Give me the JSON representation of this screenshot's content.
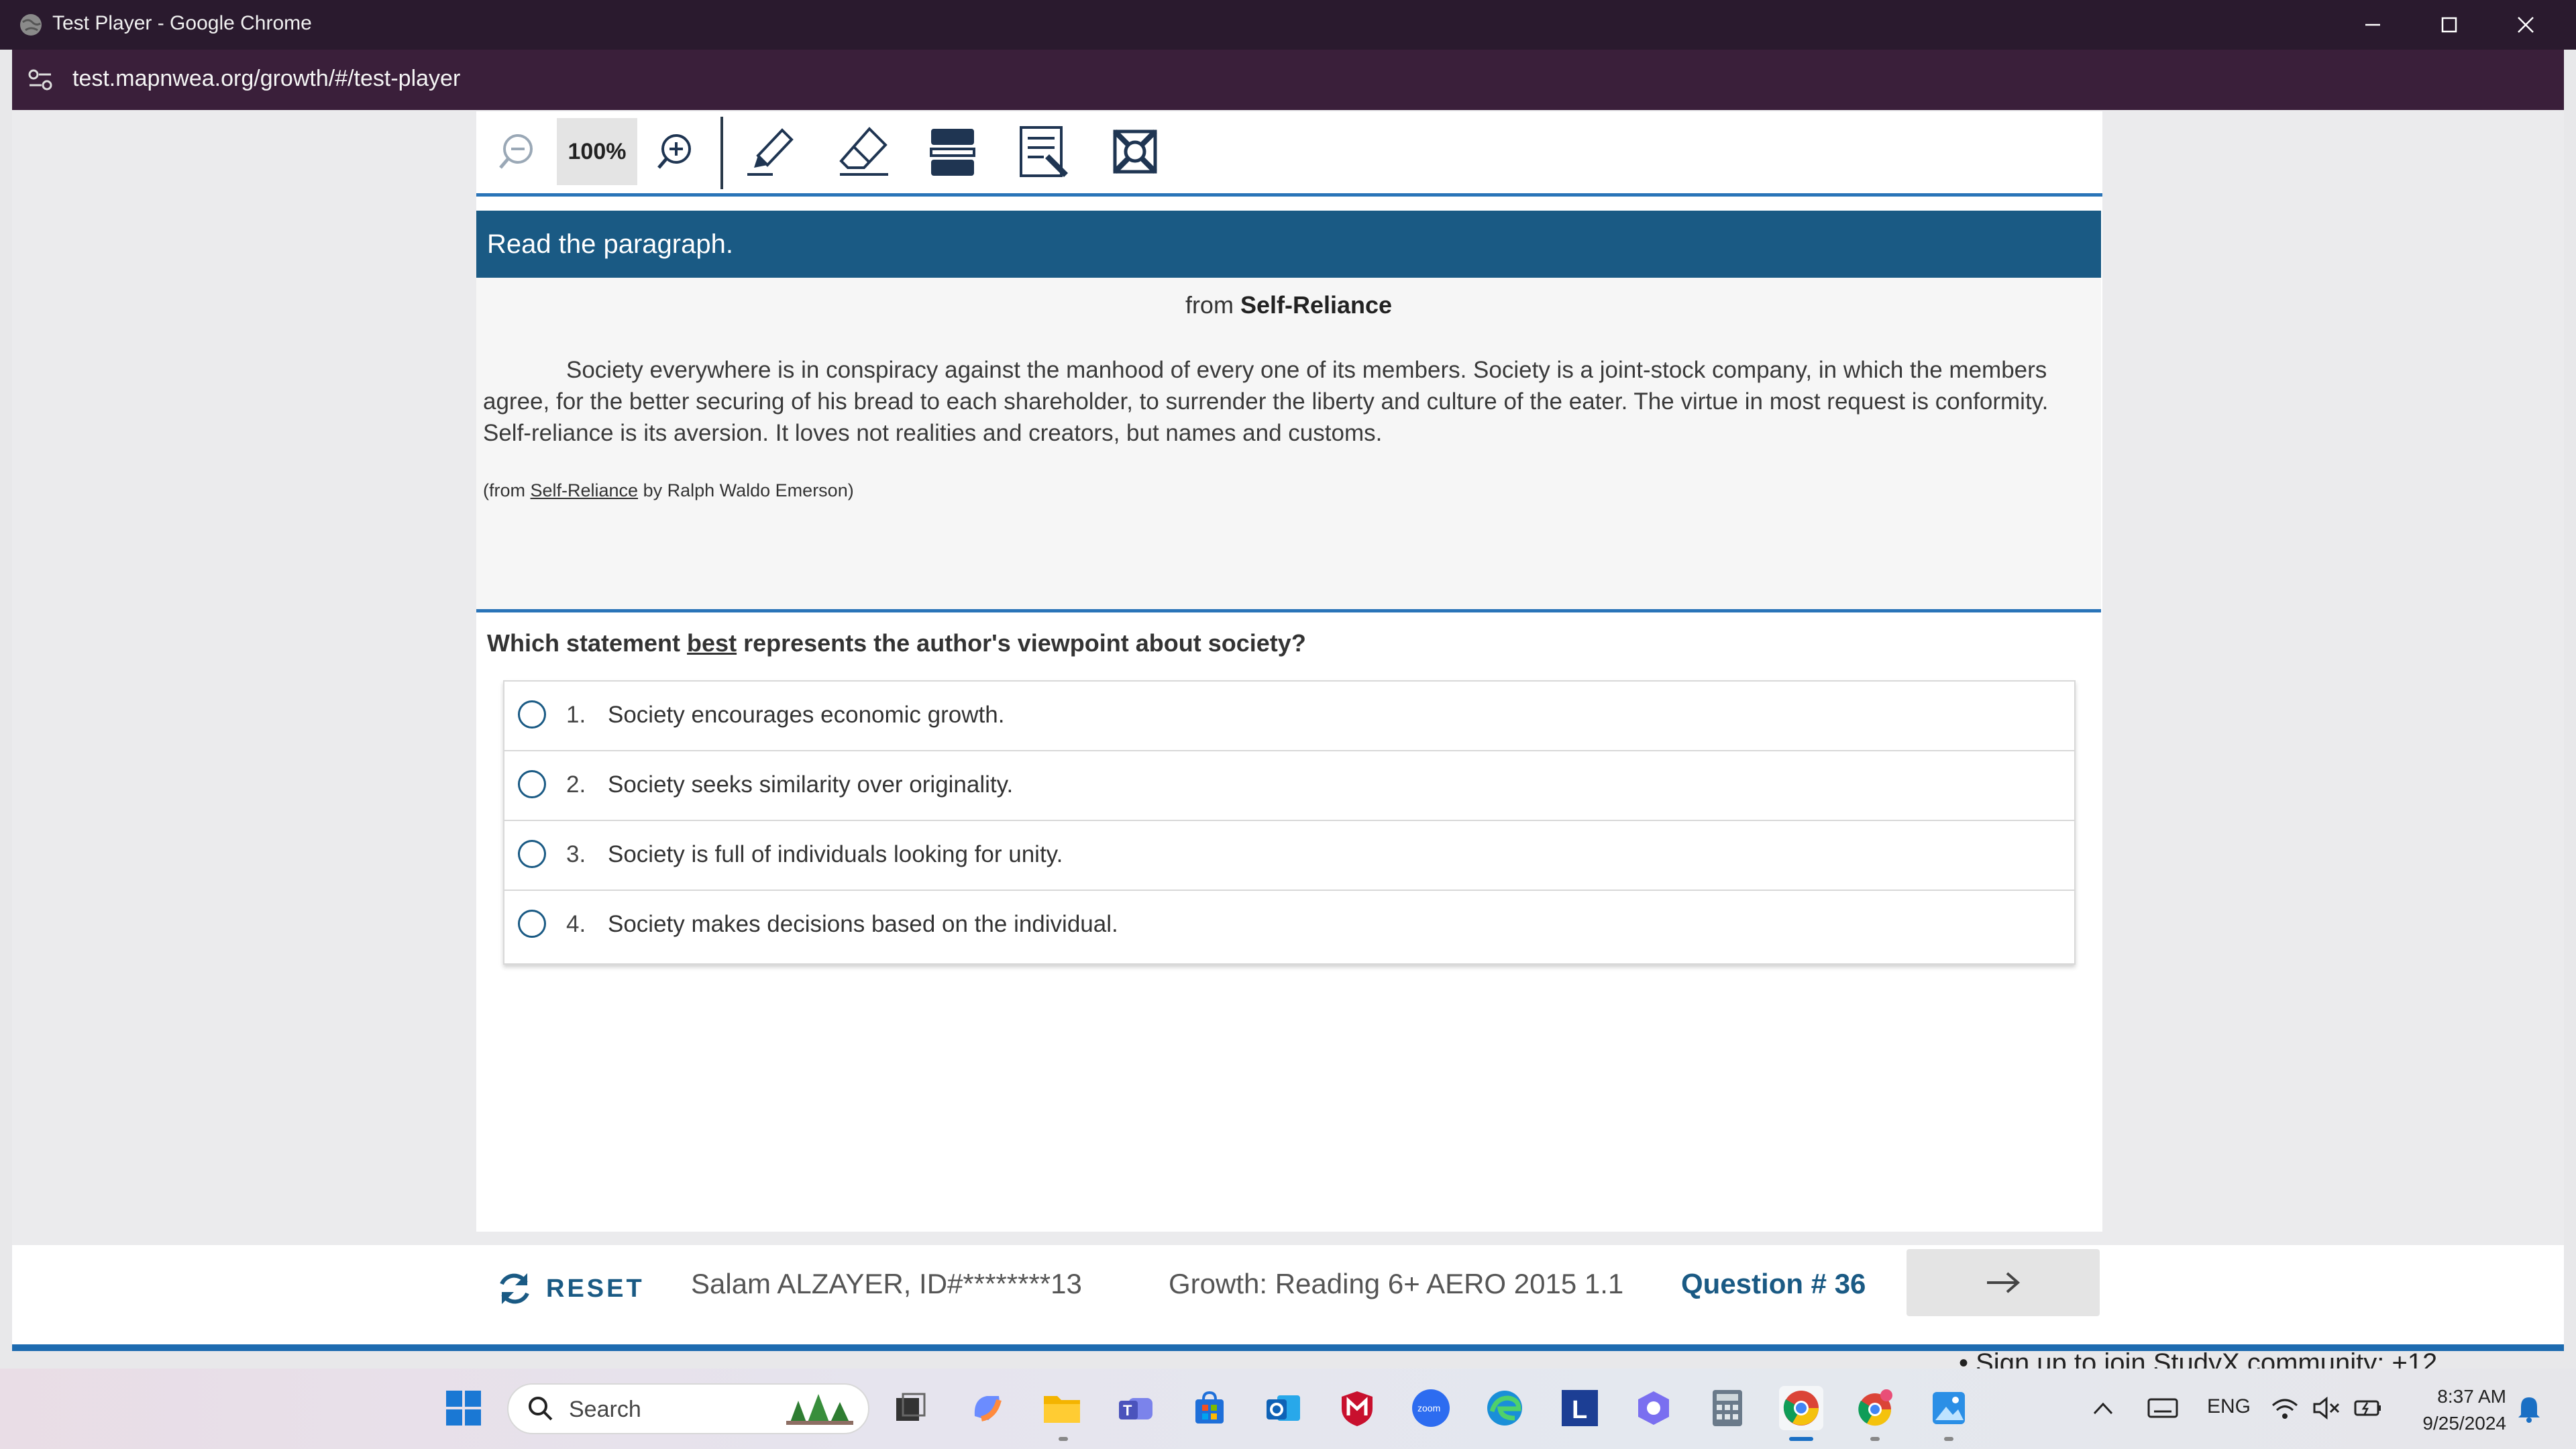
{
  "browser": {
    "window_title": "Test Player - Google Chrome",
    "url": "test.mapnwea.org/growth/#/test-player"
  },
  "toolbar": {
    "zoom_level": "100%",
    "tools": [
      "zoom-out-icon",
      "zoom-in-icon",
      "pen-icon",
      "eraser-icon",
      "line-reader-icon",
      "notepad-icon",
      "answer-eliminator-icon"
    ]
  },
  "passage": {
    "header": "Read the paragraph.",
    "source_prefix": "from ",
    "source_title": "Self-Reliance",
    "body": "Society everywhere is in conspiracy against the manhood of every one of its members. Society is a joint-stock company, in which the members agree, for the better securing of his bread to each shareholder, to surrender the liberty and culture of the eater. The virtue in most request is conformity. Self-reliance is its aversion. It loves not realities and creators, but names and customs.",
    "credit_prefix": "(from ",
    "credit_title": "Self-Reliance",
    "credit_suffix": " by Ralph Waldo Emerson)"
  },
  "question": {
    "prefix": "Which statement ",
    "emphasis": "best",
    "suffix": " represents the author's viewpoint about society?",
    "choices": [
      {
        "num": "1.",
        "text": "Society encourages economic growth."
      },
      {
        "num": "2.",
        "text": "Society seeks similarity over originality."
      },
      {
        "num": "3.",
        "text": "Society is full of individuals looking for unity."
      },
      {
        "num": "4.",
        "text": "Society makes decisions based on the individual."
      }
    ]
  },
  "footer": {
    "reset_label": "RESET",
    "student": "Salam ALZAYER, ID#********13",
    "test_name": "Growth: Reading 6+ AERO 2015 1.1",
    "question_number": "Question # 36"
  },
  "background_text": "Sign up to join StudyX community: +12",
  "taskbar": {
    "search_placeholder": "Search",
    "language": "ENG",
    "time": "8:37 AM",
    "date": "9/25/2024"
  },
  "colors": {
    "accent_blue": "#1a5a84",
    "rule_blue": "#2a74b8",
    "titlebar": "#2a1a2e"
  }
}
